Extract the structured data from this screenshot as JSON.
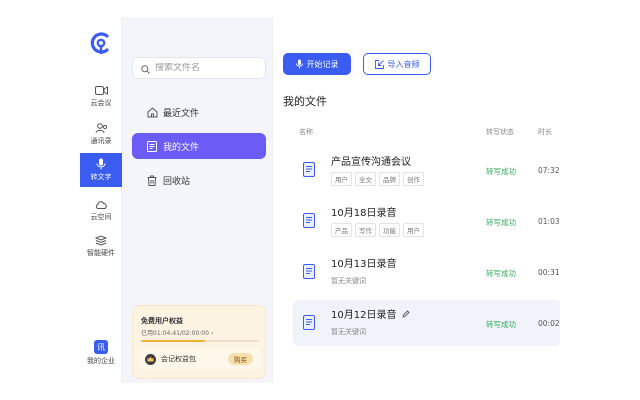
{
  "rail": {
    "items": [
      {
        "label": "云会议",
        "icon": "video-camera-icon"
      },
      {
        "label": "通讯录",
        "icon": "contacts-icon"
      },
      {
        "label": "转文字",
        "icon": "microphone-icon"
      },
      {
        "label": "云空间",
        "icon": "cloud-icon"
      },
      {
        "label": "智能硬件",
        "icon": "layers-icon"
      }
    ],
    "enterprise": {
      "badge": "讯",
      "label": "我的企业"
    },
    "active_index": 2
  },
  "sidebar": {
    "search_placeholder": "搜索文件名",
    "nav": [
      {
        "label": "最近文件",
        "icon": "home-icon"
      },
      {
        "label": "我的文件",
        "icon": "document-icon"
      },
      {
        "label": "回收站",
        "icon": "trash-icon"
      }
    ],
    "active_index": 1,
    "promo": {
      "title": "免费用户权益",
      "time": "已用01:04:41/02:00:00 ›",
      "used_fraction": 0.54,
      "package_label": "会记权益包",
      "buy_label": "购买"
    }
  },
  "main": {
    "record_button": "开始记录",
    "import_button": "导入音频",
    "title": "我的文件",
    "columns": {
      "name": "名称",
      "status": "转写状态",
      "duration": "时长"
    },
    "files": [
      {
        "name": "产品宣传沟通会议",
        "tags": [
          "用户",
          "全文",
          "品牌",
          "创作"
        ],
        "keywords_note": "",
        "status": "转写成功",
        "duration": "07:32"
      },
      {
        "name": "10月18日录音",
        "tags": [
          "产品",
          "写作",
          "功能",
          "用户"
        ],
        "keywords_note": "",
        "status": "转写成功",
        "duration": "01:03"
      },
      {
        "name": "10月13日录音",
        "tags": [],
        "keywords_note": "暂无关键词",
        "status": "转写成功",
        "duration": "00:31"
      },
      {
        "name": "10月12日录音",
        "tags": [],
        "keywords_note": "暂无关键词",
        "status": "转写成功",
        "duration": "00:02"
      }
    ],
    "active_row": 3
  },
  "colors": {
    "primary": "#3a5cf0",
    "nav_active": "#6b5cf6",
    "success": "#2fae5c",
    "promo_bg": "#fdf3e3"
  }
}
